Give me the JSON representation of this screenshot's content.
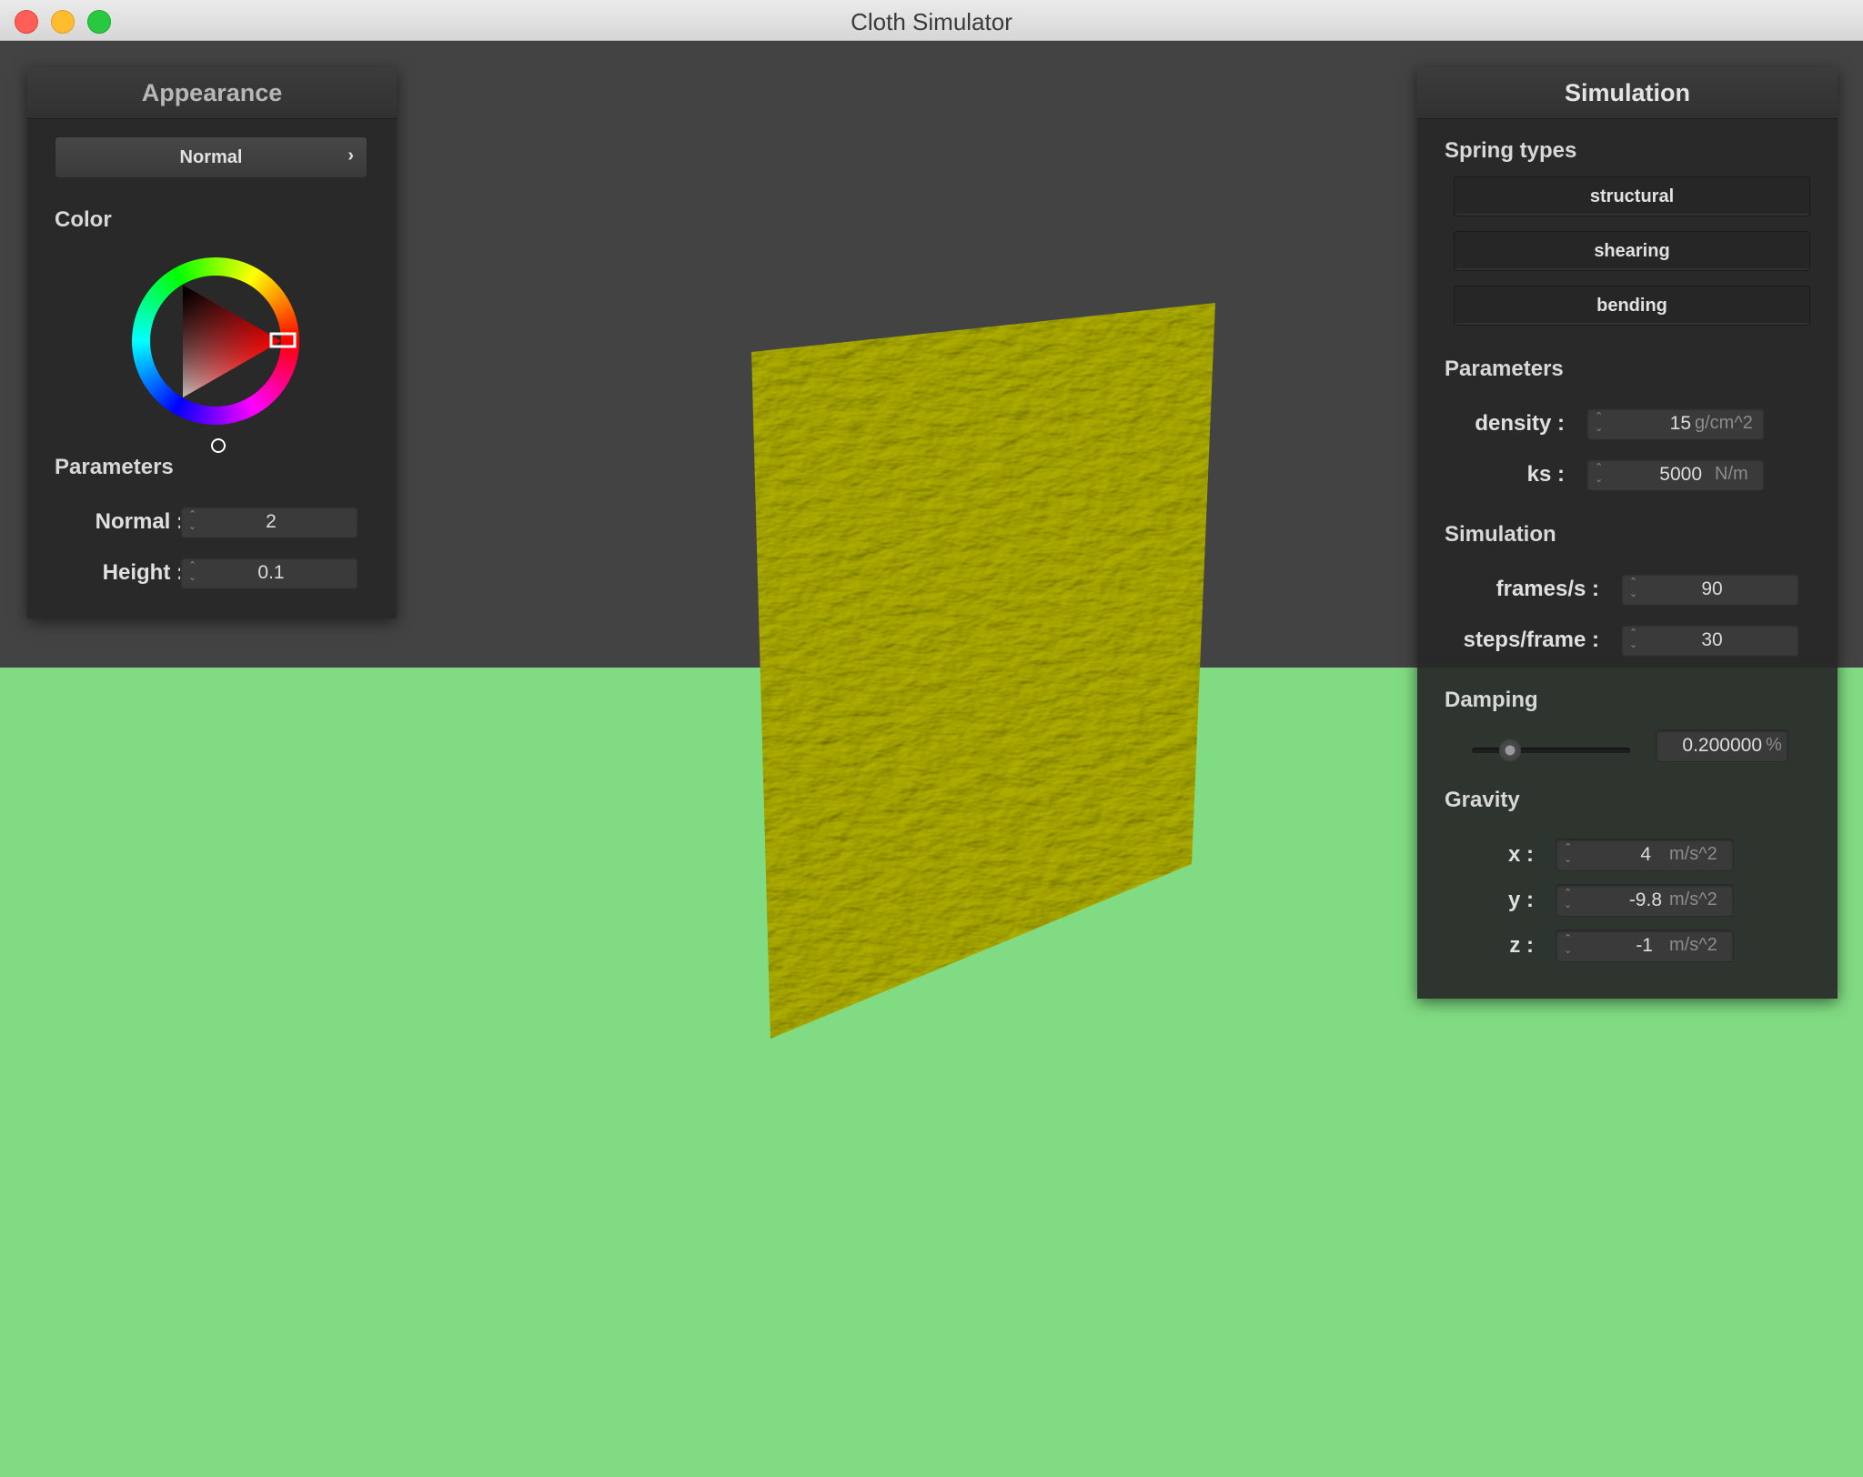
{
  "window": {
    "title": "Cloth Simulator"
  },
  "appearance_panel": {
    "title": "Appearance",
    "shader_mode": {
      "label": "Normal",
      "chevron": "›"
    },
    "color_section": "Color",
    "color_wheel": {
      "selected_hue": "#ff0000"
    },
    "parameters_section": "Parameters",
    "normal": {
      "label": "Normal :",
      "value": "2"
    },
    "height": {
      "label": "Height :",
      "value": "0.1"
    }
  },
  "simulation_panel": {
    "title": "Simulation",
    "spring_types": {
      "section": "Spring types",
      "buttons": [
        "structural",
        "shearing",
        "bending"
      ]
    },
    "parameters": {
      "section": "Parameters",
      "density": {
        "label": "density :",
        "value": "15",
        "unit": "g/cm^2"
      },
      "ks": {
        "label": "ks :",
        "value": "5000",
        "unit": "N/m"
      }
    },
    "simulation": {
      "section": "Simulation",
      "frames_per_s": {
        "label": "frames/s :",
        "value": "90"
      },
      "steps_per_frame": {
        "label": "steps/frame :",
        "value": "30"
      }
    },
    "damping": {
      "section": "Damping",
      "slider_fraction": 0.2,
      "value": "0.200000",
      "unit": "%"
    },
    "gravity": {
      "section": "Gravity",
      "x": {
        "label": "x :",
        "value": "4",
        "unit": "m/s^2"
      },
      "y": {
        "label": "y :",
        "value": "-9.8",
        "unit": "m/s^2"
      },
      "z": {
        "label": "z :",
        "value": "-1",
        "unit": "m/s^2"
      }
    }
  },
  "scene": {
    "background_color": "#434343",
    "ground_color": "#80db82",
    "cloth_color": "#8f8f00"
  }
}
